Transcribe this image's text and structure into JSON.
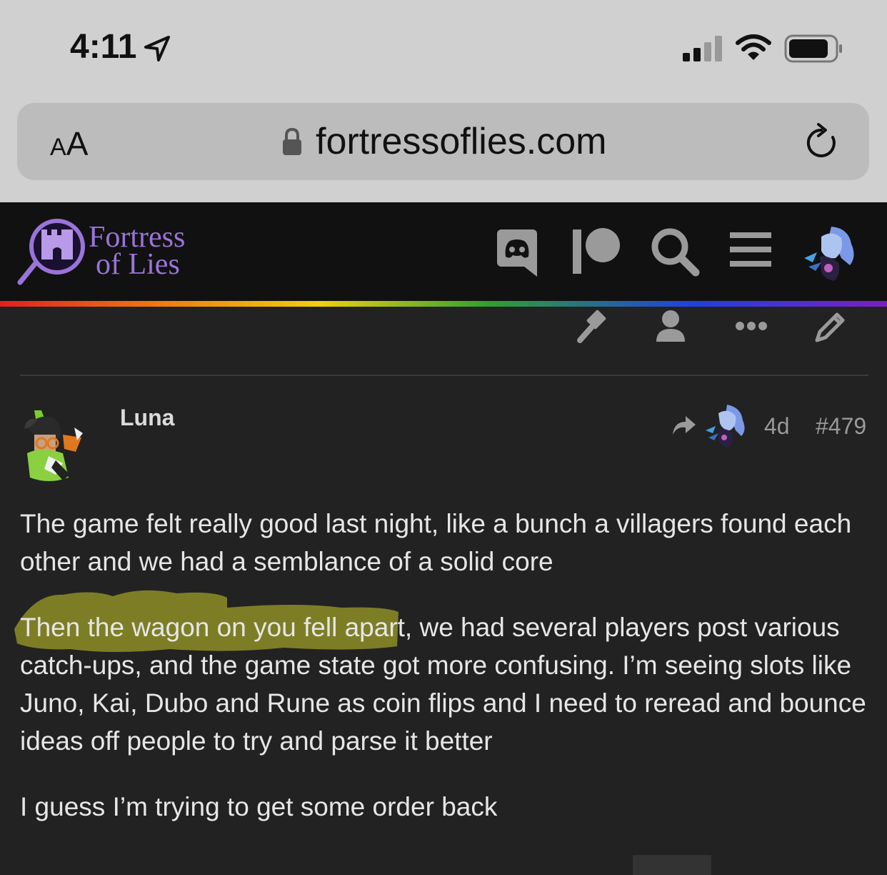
{
  "status_bar": {
    "time": "4:11",
    "icons": [
      "location-arrow-icon",
      "cellular-signal-icon",
      "wifi-icon",
      "battery-icon"
    ]
  },
  "browser": {
    "text_size_label_small": "A",
    "text_size_label_large": "A",
    "url": "fortressoflies.com",
    "icons": [
      "lock-icon",
      "reload-icon"
    ]
  },
  "site_header": {
    "logo_line1": "Fortress",
    "logo_line2": "of Lies",
    "icons": [
      "discord-icon",
      "patreon-icon",
      "search-icon",
      "hamburger-menu-icon",
      "user-avatar"
    ],
    "accent": "#9a74d8"
  },
  "topic_tools": {
    "icons": [
      "gavel-icon",
      "user-icon",
      "more-icon",
      "pencil-icon"
    ]
  },
  "post": {
    "username": "Luna",
    "reply_to_icon": "reply-arrow-icon",
    "age": "4d",
    "post_number": "#479",
    "paragraphs": [
      "The game felt really good last night, like a bunch a villagers found each other and we had a semblance of a solid core",
      "Then the wagon on you fell apart, we had several players post various catch-ups, and the game state got more confusing. I’m seeing slots like Juno, Kai, Dubo and Rune as coin flips and I need to reread and bounce ideas off people to try and parse it better",
      "I guess I’m trying to get some order back"
    ],
    "highlight_color": "#c9c92a"
  }
}
